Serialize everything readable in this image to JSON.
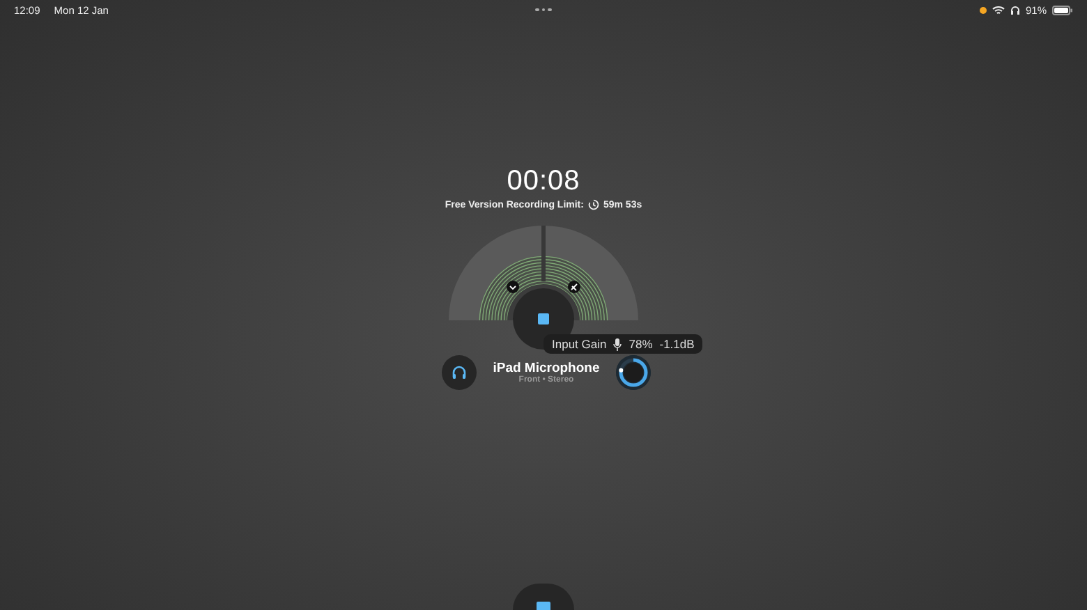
{
  "status_bar": {
    "time": "12:09",
    "date": "Mon 12 Jan",
    "battery_text": "91%"
  },
  "recorder": {
    "timer": "00:08",
    "limit_label": "Free Version Recording Limit:",
    "limit_value": "59m 53s"
  },
  "input_gain": {
    "label": "Input Gain",
    "percent": "78%",
    "db": "-1.1dB",
    "level": 0.78
  },
  "device": {
    "name": "iPad Microphone",
    "detail": "Front • Stereo"
  }
}
